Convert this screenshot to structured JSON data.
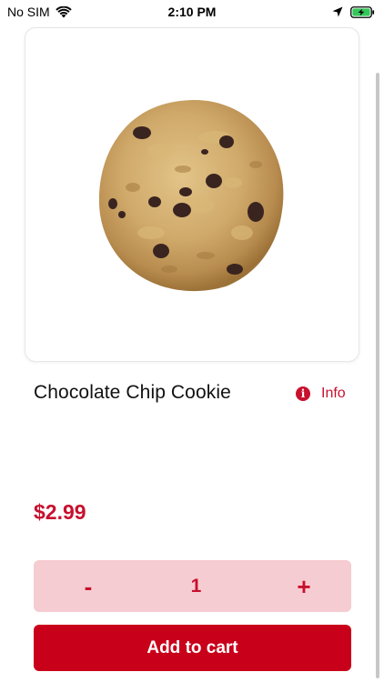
{
  "status_bar": {
    "carrier": "No SIM",
    "time": "2:10 PM",
    "icons": [
      "wifi-icon",
      "location-icon",
      "battery-charging-icon"
    ]
  },
  "product": {
    "image": "cookie",
    "name": "Chocolate Chip Cookie",
    "info_label": "Info",
    "price": "$2.99"
  },
  "quantity": {
    "decrement_label": "-",
    "value": "1",
    "increment_label": "+"
  },
  "actions": {
    "add_to_cart_label": "Add to cart"
  },
  "colors": {
    "accent": "#c8102e",
    "stepper_bg": "#f5ccd1",
    "button_bg": "#c8001a",
    "battery": "#34c759"
  }
}
